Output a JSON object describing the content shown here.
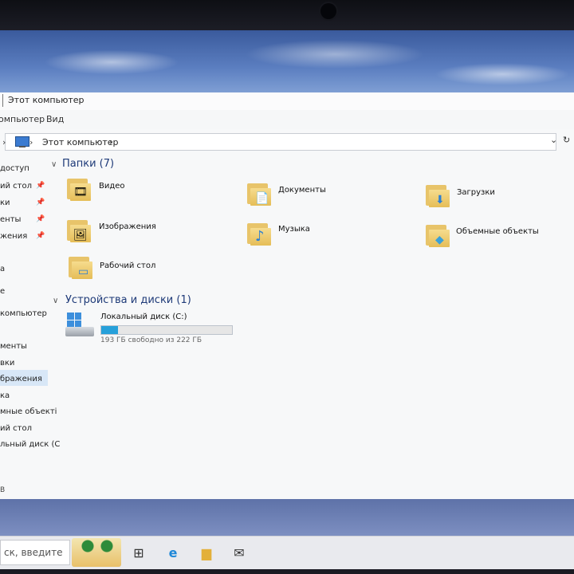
{
  "window": {
    "title": "Этот компьютер",
    "ribbon": [
      "омпьютер",
      "Вид"
    ],
    "address": {
      "path": "Этот компьютер",
      "separator_prefix": "›",
      "separator_suffix": "›"
    }
  },
  "navigation": {
    "items": [
      {
        "label": "доступ",
        "pinned": false
      },
      {
        "label": "ий стол",
        "pinned": true
      },
      {
        "label": "ки",
        "pinned": true
      },
      {
        "label": "енты",
        "pinned": true
      },
      {
        "label": "жения",
        "pinned": true
      },
      {
        "label": "а",
        "pinned": false
      },
      {
        "label": "е",
        "pinned": false
      },
      {
        "label": "компьютер",
        "pinned": false
      },
      {
        "label": "менты",
        "pinned": false
      },
      {
        "label": "вки",
        "pinned": false
      },
      {
        "label": "бражения",
        "pinned": false
      },
      {
        "label": "ка",
        "pinned": false
      },
      {
        "label": "мные объекті",
        "pinned": false
      },
      {
        "label": "ий стол",
        "pinned": false
      },
      {
        "label": "льный диск (С",
        "pinned": false
      }
    ],
    "pin_glyph": "📌",
    "status": "В"
  },
  "content": {
    "folders_section": "Папки (7)",
    "folders": [
      {
        "label": "Видео",
        "icon": "video-folder-icon",
        "glyph": "🎞"
      },
      {
        "label": "Документы",
        "icon": "documents-folder-icon",
        "glyph": "📄"
      },
      {
        "label": "Загрузки",
        "icon": "downloads-folder-icon",
        "glyph": "⬇"
      },
      {
        "label": "Изображения",
        "icon": "pictures-folder-icon",
        "glyph": "🖼"
      },
      {
        "label": "Музыка",
        "icon": "music-folder-icon",
        "glyph": "♪"
      },
      {
        "label": "Объемные объекты",
        "icon": "3d-objects-folder-icon",
        "glyph": "◆"
      },
      {
        "label": "Рабочий стол",
        "icon": "desktop-folder-icon",
        "glyph": "▭"
      }
    ],
    "devices_section": "Устройства и диски (1)",
    "drive": {
      "name": "Локальный диск (C:)",
      "free_text": "193 ГБ свободно из 222 ГБ",
      "used_fraction": 0.13
    }
  },
  "taskbar": {
    "search_text": "ск, введите",
    "buttons": [
      {
        "name": "task-view-icon",
        "glyph": "⊞"
      },
      {
        "name": "edge-icon",
        "glyph": "e"
      },
      {
        "name": "file-explorer-icon",
        "glyph": "▆"
      },
      {
        "name": "mail-icon",
        "glyph": "✉"
      }
    ]
  },
  "colors": {
    "accent": "#26a0da",
    "section_heading": "#1e3a78",
    "selection": "#d8e7f7"
  }
}
